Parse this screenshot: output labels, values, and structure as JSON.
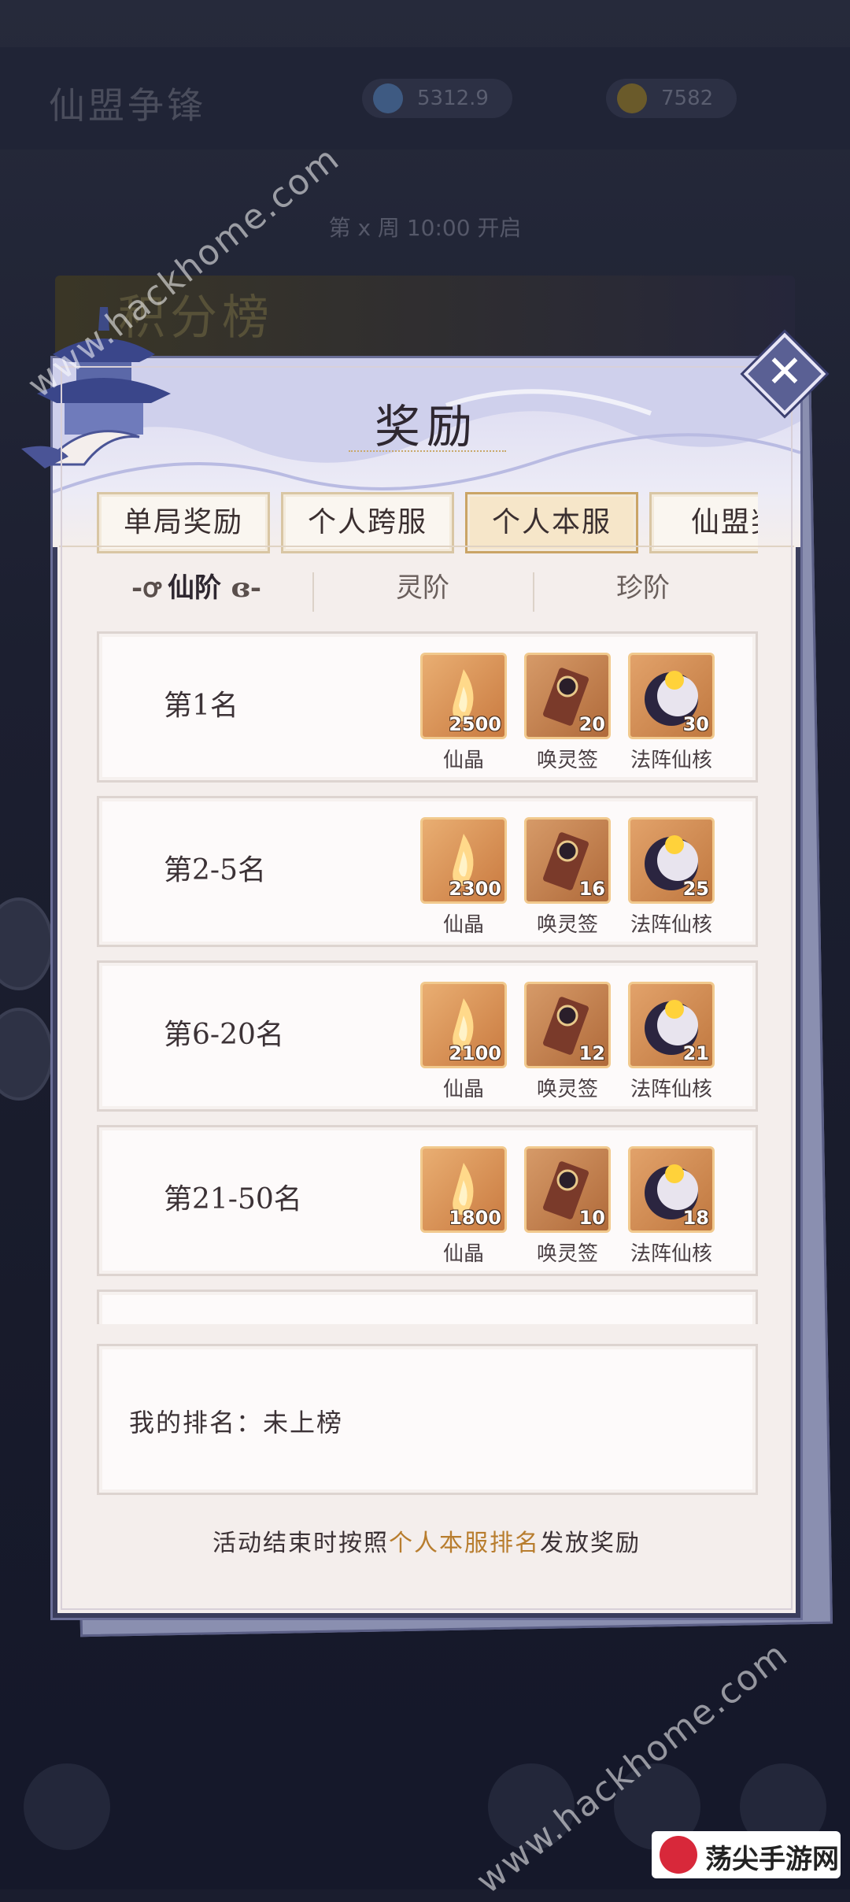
{
  "background": {
    "title": "仙盟争锋",
    "res1": "5312.9",
    "res2": "7582",
    "nav": "第 x 周 10:00 开启",
    "banner": "积分榜"
  },
  "panel": {
    "title": "奖励",
    "close": "✕",
    "tabs": [
      "单局奖励",
      "个人跨服",
      "个人本服",
      "仙盟奖"
    ],
    "active_tab": "个人本服",
    "subtabs": [
      "仙阶",
      "灵阶",
      "珍阶"
    ],
    "active_subtab": "仙阶"
  },
  "rewards": [
    {
      "rank": "第1名",
      "items": [
        {
          "name": "仙晶",
          "count": "2500"
        },
        {
          "name": "唤灵签",
          "count": "20"
        },
        {
          "name": "法阵仙核",
          "count": "30"
        }
      ]
    },
    {
      "rank": "第2-5名",
      "items": [
        {
          "name": "仙晶",
          "count": "2300"
        },
        {
          "name": "唤灵签",
          "count": "16"
        },
        {
          "name": "法阵仙核",
          "count": "25"
        }
      ]
    },
    {
      "rank": "第6-20名",
      "items": [
        {
          "name": "仙晶",
          "count": "2100"
        },
        {
          "name": "唤灵签",
          "count": "12"
        },
        {
          "name": "法阵仙核",
          "count": "21"
        }
      ]
    },
    {
      "rank": "第21-50名",
      "items": [
        {
          "name": "仙晶",
          "count": "1800"
        },
        {
          "name": "唤灵签",
          "count": "10"
        },
        {
          "name": "法阵仙核",
          "count": "18"
        }
      ]
    }
  ],
  "my_rank": "我的排名：未上榜",
  "footer": {
    "pre": "活动结束时按照",
    "highlight": "个人本服排名",
    "post": "发放奖励"
  },
  "watermark": "www.hackhome.com",
  "logo": "荡尖手游网",
  "colors": {
    "accent": "#b87d2e",
    "panel_border": "#6a6e97",
    "item_bg": "#d98b4a"
  }
}
